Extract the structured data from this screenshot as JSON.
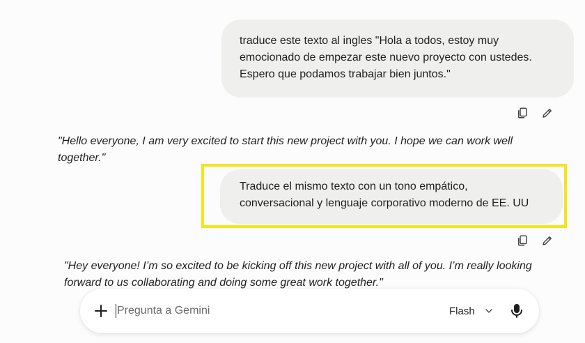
{
  "conversation": {
    "user_message_1": {
      "lines": [
        "traduce este texto al ingles \"Hola a todos, estoy muy",
        "emocionado de empezar este nuevo proyecto con ustedes.",
        "Espero que podamos trabajar bien juntos.\""
      ]
    },
    "response_1": {
      "lines": [
        "\"Hello everyone, I am very excited to start this new project with you. I hope we can work well",
        "together.\""
      ]
    },
    "user_message_2": {
      "lines": [
        "Traduce el mismo texto con un tono empático,",
        "conversacional y lenguaje corporativo moderno de EE. UU"
      ],
      "highlight_color": "#f4e41d"
    },
    "response_2": {
      "lines": [
        "\"Hey everyone! I’m so excited to be kicking off this new project with all of you. I’m really looking",
        "forward to us collaborating and doing some great work together.\""
      ]
    }
  },
  "message_actions": {
    "copy_icon": "copy-icon",
    "edit_icon": "pencil-icon"
  },
  "input_bar": {
    "placeholder": "Pregunta a Gemini",
    "model_label": "Flash",
    "add_icon": "plus-icon",
    "dropdown_icon": "chevron-down-icon",
    "mic_icon": "microphone-icon"
  },
  "colors": {
    "background": "#fdfcfc",
    "bubble": "#efefee",
    "text": "#1f1f1f",
    "highlight": "#f4e41d"
  }
}
